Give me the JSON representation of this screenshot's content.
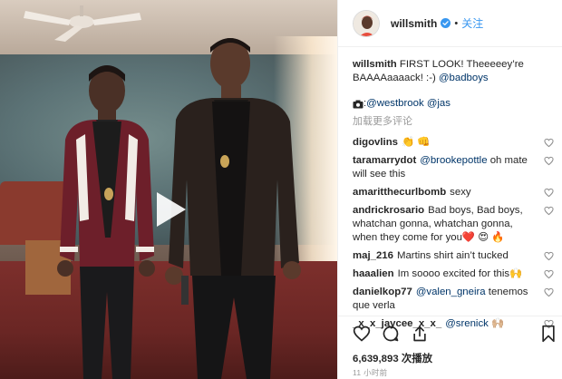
{
  "header": {
    "username": "willsmith",
    "separator": "•",
    "follow_label": "关注"
  },
  "caption": {
    "username": "willsmith",
    "text": "FIRST LOOK! Theeeeey’re BAAAAaaaack! :-) ",
    "mention": "@badboys"
  },
  "credits": {
    "camera_icon": "camera-icon",
    "separator": ": ",
    "mention1": "@westbrook",
    "mention2": "@jas"
  },
  "load_more_label": "加载更多评论",
  "comments": [
    {
      "username": "digovlins",
      "text": "👏 👊"
    },
    {
      "username": "taramarrydot",
      "mention": "@brookepottle",
      "text": " oh mate will see this"
    },
    {
      "username": "amaritthecurlbomb",
      "text": "sexy"
    },
    {
      "username": "andrickrosario",
      "text": "Bad boys, Bad boys, whatchan gonna, whatchan gonna, when they come for you❤️ 😍 🔥"
    },
    {
      "username": "maj_216",
      "text": "Martins shirt ain’t tucked"
    },
    {
      "username": "haaalien",
      "text": "Im soooo excited for this🙌"
    },
    {
      "username": "danielkop77",
      "mention": "@valen_gneira",
      "text": " tenemos que verla"
    },
    {
      "username": "_x_x_jaycee_x_x_",
      "mention": "@srenick",
      "text": " 🙌🏼"
    }
  ],
  "stats": {
    "views_count": "6,639,893",
    "views_label": " 次播放",
    "timestamp": "11 小时前"
  },
  "colors": {
    "link": "#003569",
    "follow": "#3897f0",
    "verified": "#3897f0",
    "muted": "#999999"
  }
}
